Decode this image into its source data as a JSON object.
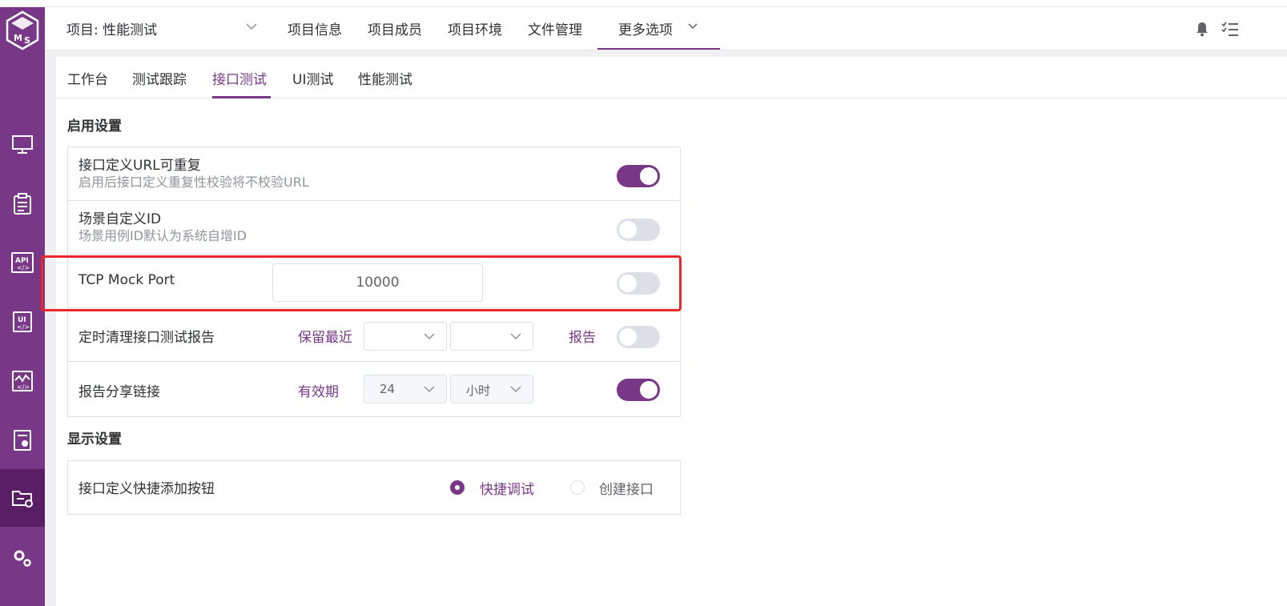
{
  "colors": {
    "brand": "#783887",
    "brand_dark": "#5a1e66",
    "highlight": "#e8292c"
  },
  "header": {
    "project_select": "项目: 性能测试",
    "nav": [
      "项目信息",
      "项目成员",
      "项目环境",
      "文件管理"
    ],
    "more": "更多选项",
    "icons": [
      "bell-icon",
      "checklist-icon"
    ]
  },
  "sidebar": {
    "icons": [
      "monitor-icon",
      "clipboard-icon",
      "api-icon",
      "ui-icon",
      "performance-icon",
      "report-icon",
      "project-folder-icon",
      "settings-icon"
    ],
    "active": "project-folder-icon"
  },
  "subtabs": [
    "工作台",
    "测试跟踪",
    "接口测试",
    "UI测试",
    "性能测试"
  ],
  "active_subtab": "接口测试",
  "enable_settings": {
    "title": "启用设置",
    "url_repeatable": {
      "title": "接口定义URL可重复",
      "desc": "启用后接口定义重复性校验将不校验URL",
      "enabled": true
    },
    "scenario_custom_id": {
      "title": "场景自定义ID",
      "desc": "场景用例ID默认为系统自增ID",
      "enabled": false
    },
    "tcp_mock_port": {
      "title": "TCP Mock Port",
      "value": "10000",
      "enabled": false
    },
    "cleanup_reports": {
      "title": "定时清理接口测试报告",
      "prefix": "保留最近",
      "value": "",
      "unit": "",
      "suffix": "报告",
      "enabled": false
    },
    "share_link": {
      "title": "报告分享链接",
      "prefix": "有效期",
      "value": "24",
      "unit": "小时",
      "enabled": true
    }
  },
  "display_settings": {
    "title": "显示设置",
    "quick_add": {
      "title": "接口定义快捷添加按钮",
      "options": [
        "快捷调试",
        "创建接口"
      ],
      "selected": "快捷调试"
    }
  }
}
